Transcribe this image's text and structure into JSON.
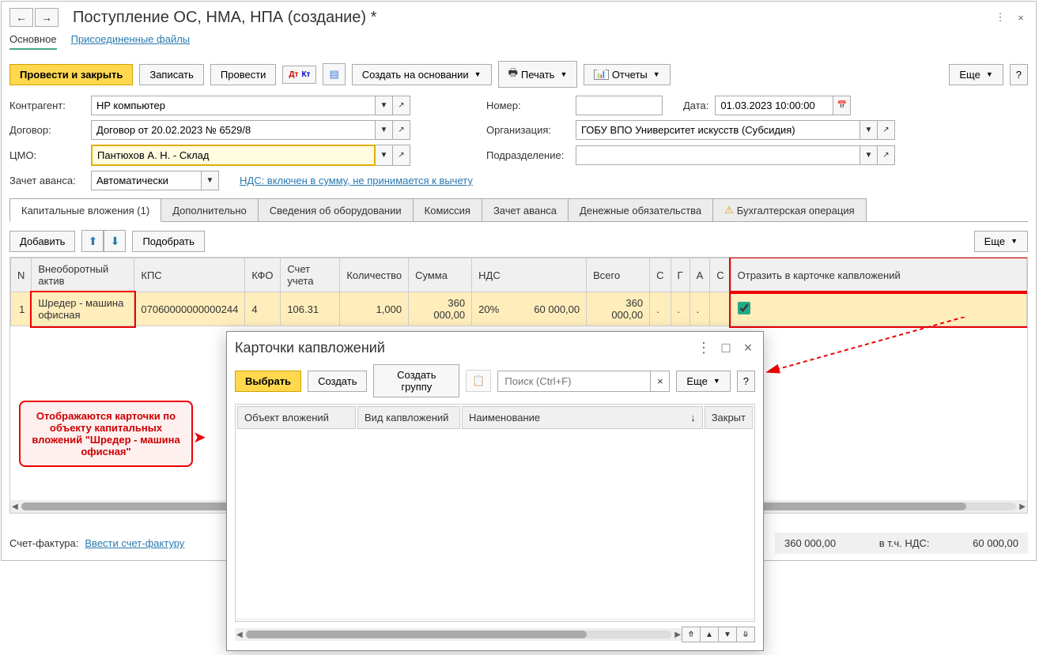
{
  "title": "Поступление ОС, НМА, НПА (создание) *",
  "section_tabs": {
    "main": "Основное",
    "attached": "Присоединенные файлы"
  },
  "toolbar": {
    "post_close": "Провести и закрыть",
    "write": "Записать",
    "post": "Провести",
    "create_based": "Создать на основании",
    "print": "Печать",
    "reports": "Отчеты",
    "more": "Еще"
  },
  "form": {
    "counterparty_label": "Контрагент:",
    "counterparty": "HP компьютер",
    "number_label": "Номер:",
    "number": "",
    "date_label": "Дата:",
    "date": "01.03.2023 10:00:00",
    "contract_label": "Договор:",
    "contract": "Договор от 20.02.2023 № 6529/8",
    "org_label": "Организация:",
    "org": "ГОБУ ВПО Университет искусств (Субсидия)",
    "cmo_label": "ЦМО:",
    "cmo": "Пантюхов А. Н. - Склад",
    "dept_label": "Подразделение:",
    "dept": "",
    "advance_label": "Зачет аванса:",
    "advance": "Автоматически",
    "nds_link": "НДС: включен в сумму, не принимается к вычету"
  },
  "tabs": {
    "cap": "Капитальные вложения (1)",
    "add": "Дополнительно",
    "equip": "Сведения об оборудовании",
    "commission": "Комиссия",
    "advance": "Зачет аванса",
    "money": "Денежные обязательства",
    "accounting": "Бухгалтерская операция"
  },
  "subbar": {
    "add": "Добавить",
    "pick": "Подобрать",
    "more": "Еще"
  },
  "table": {
    "headers": {
      "n": "N",
      "asset": "Внеоборотный актив",
      "kps": "КПС",
      "kfo": "КФО",
      "account": "Счет учета",
      "qty": "Количество",
      "sum": "Сумма",
      "nds": "НДС",
      "total": "Всего",
      "c": "С",
      "g": "Г",
      "am": "А",
      "s2": "С",
      "reflect": "Отразить в карточке капвложений"
    },
    "row": {
      "n": "1",
      "asset": "Шредер - машина офисная",
      "kps": "07060000000000244",
      "kfo": "4",
      "account": "106.31",
      "qty": "1,000",
      "sum": "360 000,00",
      "nds_rate": "20%",
      "nds_amount": "60 000,00",
      "total": "360 000,00",
      "c": ".",
      "g": ".",
      "am": ".",
      "reflect": true
    }
  },
  "footer": {
    "invoice_label": "Счет-фактура:",
    "invoice_link": "Ввести счет-фактуру",
    "total": "360 000,00",
    "nds_label": "в т.ч. НДС:",
    "nds": "60 000,00"
  },
  "popup": {
    "title": "Карточки капвложений",
    "select": "Выбрать",
    "create": "Создать",
    "create_group": "Создать группу",
    "search_placeholder": "Поиск (Ctrl+F)",
    "more": "Еще",
    "headers": {
      "object": "Объект вложений",
      "type": "Вид капвложений",
      "name": "Наименование",
      "closed": "Закрыт"
    }
  },
  "callout": "Отображаются карточки по объекту капитальных вложений \"Шредер - машина офисная\""
}
